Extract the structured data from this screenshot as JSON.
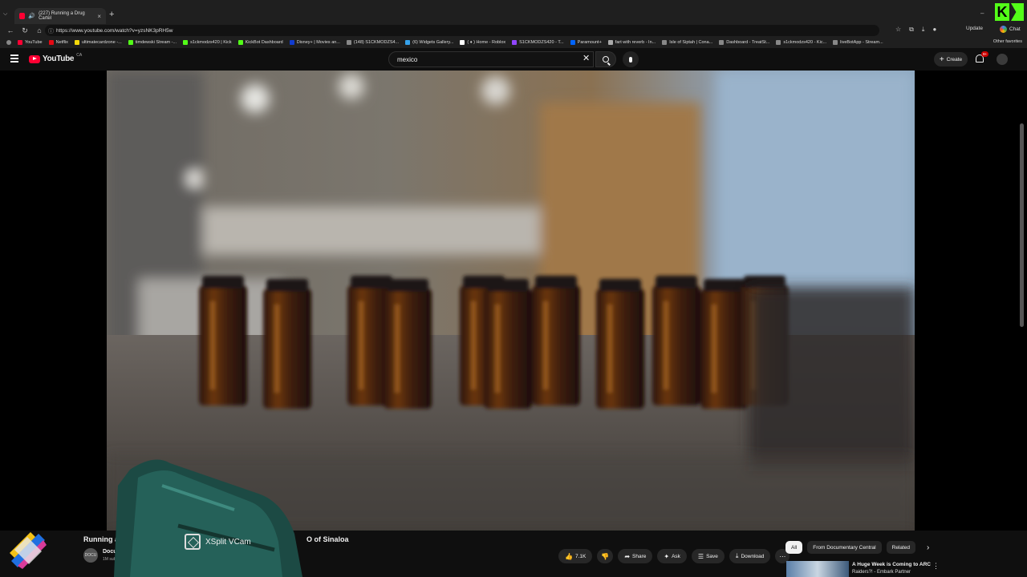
{
  "browser": {
    "tab_title": "(227) Running a Drug Cartel",
    "url": "https://www.youtube.com/watch?v=yzsNK3pRH5w",
    "update_label": "Update",
    "chat_label": "Chat",
    "bookmarks": [
      "YouTube",
      "Netflix",
      "ultimatecardzone -...",
      "timdewski Stream -...",
      "s1ckmodzs420 | Kick",
      "KickBot Dashboard",
      "Disney+ | Movies an...",
      "(148) S1CKMODZS4...",
      "(6) Widgets Gallery...",
      "( ♦ ) Home - Roblox",
      "S1CKMODZS420 - T...",
      "Paramount+",
      "fart with reverb - In...",
      "Isle of Siptah | Cona...",
      "Dashboard - TreatSt...",
      "s1ckmodzs420 - Kic...",
      "liveBotApp - Stream..."
    ],
    "other_favorites": "Other favorites"
  },
  "youtube": {
    "logo_text": "YouTube",
    "region": "CA",
    "search_value": "mexico",
    "create_label": "Create",
    "notification_count": "9+"
  },
  "video": {
    "title_start": "Running a D",
    "title_end": "O of Sinaloa",
    "channel_initials": "DOCU",
    "channel_name": "Documen",
    "subscribers": "1M subscrib"
  },
  "overlay": {
    "xsplit_label": "XSplit VCam"
  },
  "actions": {
    "like_count": "7.1K",
    "share_label": "Share",
    "ask_label": "Ask",
    "save_label": "Save",
    "download_label": "Download"
  },
  "chips": [
    "All",
    "From Documentary Central",
    "Related"
  ],
  "recommendation": {
    "title": "A Huge Week is Coming to ARC",
    "subtitle": "Raiders?! - Embark Partner"
  },
  "colors": {
    "yt_red": "#ff0033",
    "kick_green": "#53fc18",
    "background": "#0f0f0f"
  }
}
